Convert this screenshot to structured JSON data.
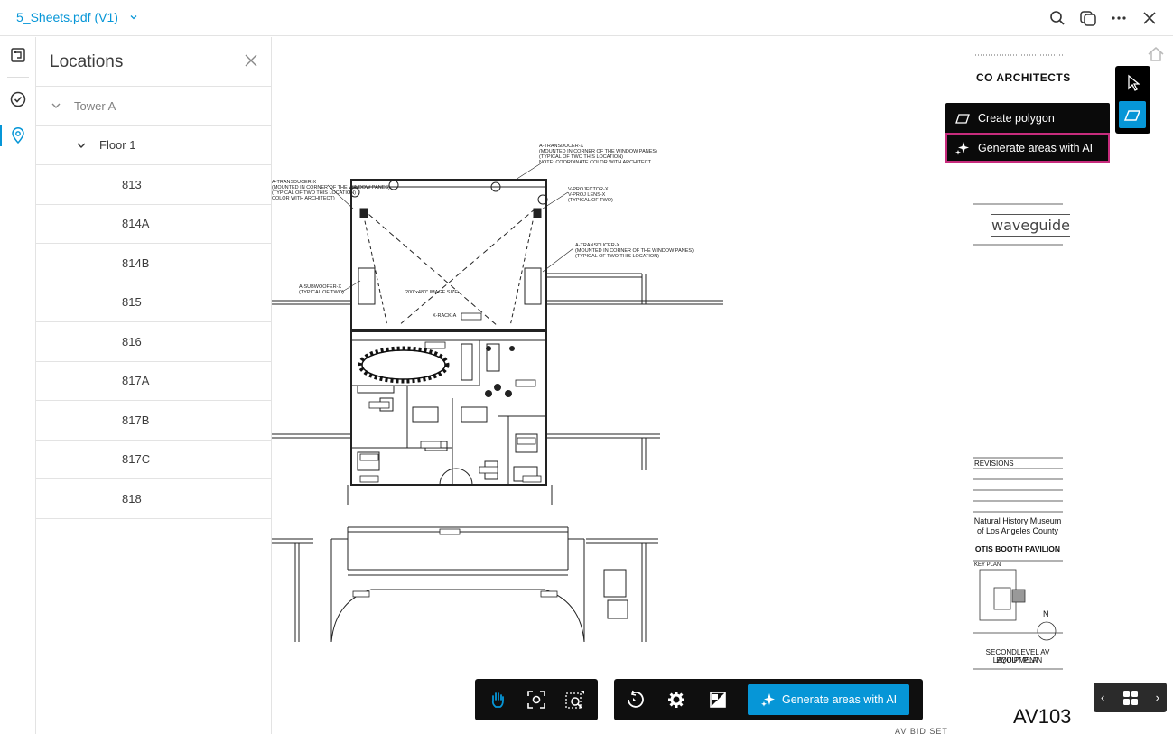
{
  "header": {
    "file_name": "5_Sheets.pdf",
    "version": "(V1)",
    "icons": [
      "search-icon",
      "compare-icon",
      "more-icon",
      "close-icon"
    ]
  },
  "rail": {
    "icons": [
      "sheets-icon",
      "issues-icon",
      "locations-icon"
    ],
    "active": "locations-icon"
  },
  "locations_panel": {
    "title": "Locations",
    "tree": [
      {
        "label": "Tower A",
        "level": 0,
        "expanded": true
      },
      {
        "label": "Floor 1",
        "level": 1,
        "expanded": true
      },
      {
        "label": "813",
        "level": 2
      },
      {
        "label": "814A",
        "level": 2
      },
      {
        "label": "814B",
        "level": 2
      },
      {
        "label": "815",
        "level": 2
      },
      {
        "label": "816",
        "level": 2
      },
      {
        "label": "817A",
        "level": 2
      },
      {
        "label": "817B",
        "level": 2
      },
      {
        "label": "817C",
        "level": 2
      },
      {
        "label": "818",
        "level": 2
      }
    ]
  },
  "sheet": {
    "logo": "CO ARCHITECTS",
    "consultant": "waveguide",
    "revisions_label": "REVISIONS",
    "client_line1": "Natural History Museum",
    "client_line2": "of Los Angeles County",
    "project": "OTIS BOOTH PAVILION",
    "key_plan_label": "KEY PLAN",
    "sheet_title_line1": "SECONDLEVEL AV EQUIPMENT",
    "sheet_title_line2": "LAYOUT PLAN",
    "sheet_number": "AV103",
    "bid_set": "AV BID SET",
    "north": "N"
  },
  "area_menu": {
    "create_polygon": "Create polygon",
    "generate_ai": "Generate areas with AI"
  },
  "bottom_toolbar": {
    "tools_left": [
      "pan-icon",
      "fit-view-icon",
      "zoom-window-icon"
    ],
    "tools_mid": [
      "rotate-icon",
      "settings-icon",
      "compare-sheets-icon"
    ],
    "generate_label": "Generate areas with AI"
  },
  "pager": {
    "prev": "‹",
    "next": "›"
  },
  "colors": {
    "accent": "#0696d7",
    "highlight": "#c72c7d",
    "toolbar": "#0f0f0f"
  }
}
